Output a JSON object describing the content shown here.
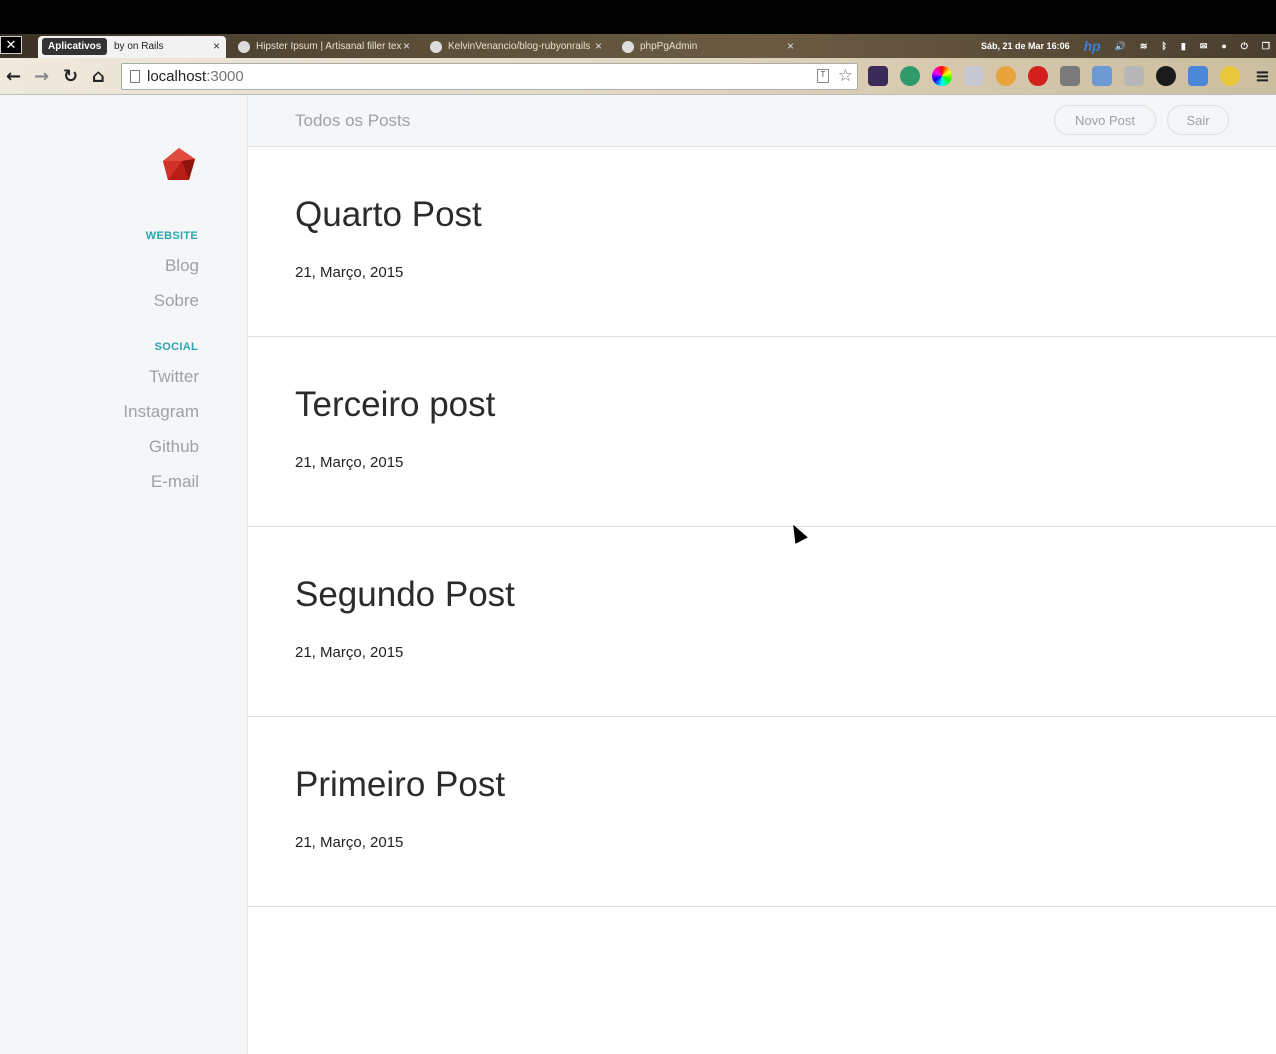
{
  "browser": {
    "apps_label": "Aplicativos",
    "tabs": [
      {
        "label": "by on Rails"
      },
      {
        "label": "Hipster Ipsum | Artisanal filler tex"
      },
      {
        "label": "KelvinVenancio/blog-rubyonrails"
      },
      {
        "label": "phpPgAdmin"
      }
    ],
    "tab_close": "×",
    "system": {
      "datetime": "Sáb, 21 de Mar 16:06",
      "hp": "hp"
    },
    "url": {
      "host": "localhost",
      "port": ":3000"
    },
    "icons": {
      "close": "✕",
      "back": "←",
      "forward": "→",
      "reload": "↻",
      "home": "⌂",
      "star": "☆",
      "menu": "≡",
      "translate": "T"
    }
  },
  "app": {
    "header": {
      "title": "Todos os Posts",
      "new_post_button": "Novo Post",
      "logout_button": "Sair"
    },
    "sidebar": {
      "website_heading": "WEBSITE",
      "website_links": [
        "Blog",
        "Sobre"
      ],
      "social_heading": "SOCIAL",
      "social_links": [
        "Twitter",
        "Instagram",
        "Github",
        "E-mail"
      ]
    },
    "posts": [
      {
        "title": "Quarto Post",
        "date": "21, Março, 2015"
      },
      {
        "title": "Terceiro post",
        "date": "21, Março, 2015"
      },
      {
        "title": "Segundo Post",
        "date": "21, Março, 2015"
      },
      {
        "title": "Primeiro Post",
        "date": "21, Março, 2015"
      }
    ]
  },
  "colors": {
    "accent": "#2aa6b0",
    "muted_text": "#9aa3a8",
    "sidebar_bg": "#f5f6f7",
    "ruby_red": "#c0241b"
  }
}
